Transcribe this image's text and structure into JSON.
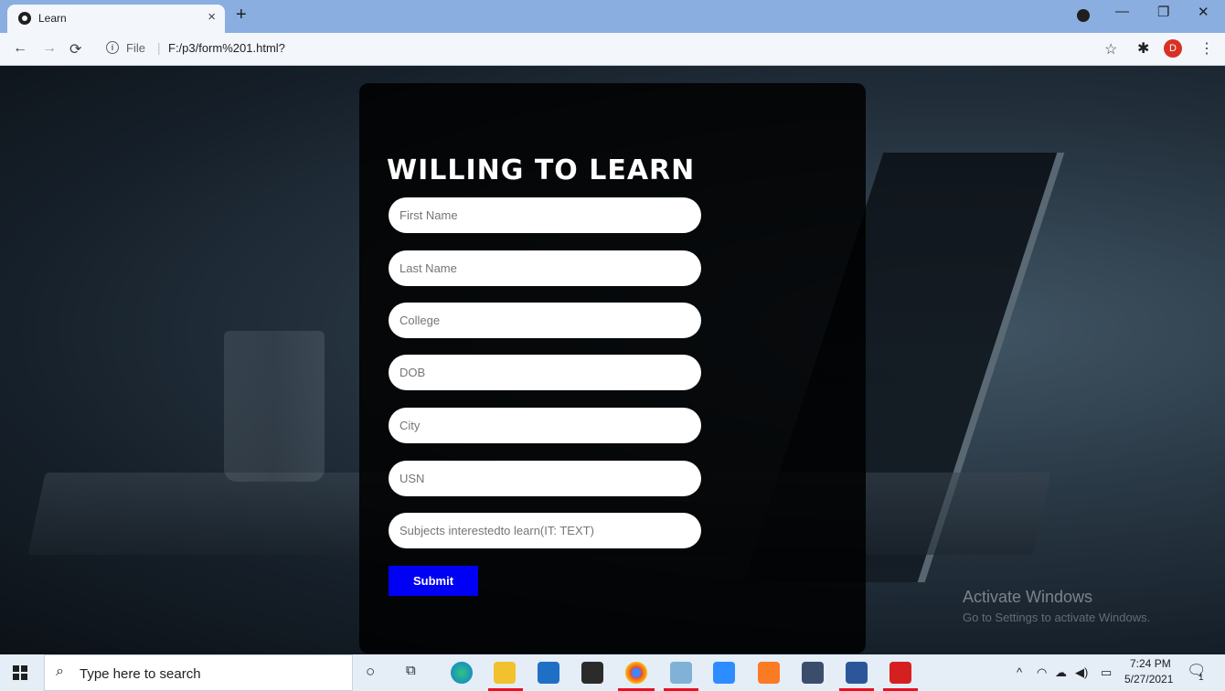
{
  "browser": {
    "tab_title": "Learn",
    "tab_close": "×",
    "new_tab": "+",
    "url_scheme_label": "File",
    "url": "F:/p3/form%201.html?",
    "profile_initial": "D"
  },
  "form": {
    "title": "WILLING TO LEARN",
    "fields": [
      {
        "placeholder": "First Name"
      },
      {
        "placeholder": "Last Name"
      },
      {
        "placeholder": "College"
      },
      {
        "placeholder": "DOB"
      },
      {
        "placeholder": "City"
      },
      {
        "placeholder": "USN"
      },
      {
        "placeholder": "Subjects interestedto learn(IT: TEXT)"
      }
    ],
    "submit_label": "Submit"
  },
  "watermark": {
    "line1": "Activate Windows",
    "line2": "Go to Settings to activate Windows."
  },
  "taskbar": {
    "search_placeholder": "Type here to search",
    "time": "7:24 PM",
    "date": "5/27/2021",
    "notification_count": "1",
    "apps": [
      "cortana-icon",
      "task-view-icon",
      "edge-icon",
      "file-explorer-icon",
      "mail-icon",
      "store-icon",
      "chrome-icon",
      "app-icon",
      "zoom-icon",
      "xampp-icon",
      "app-icon-2",
      "word-icon",
      "acrobat-icon"
    ]
  }
}
